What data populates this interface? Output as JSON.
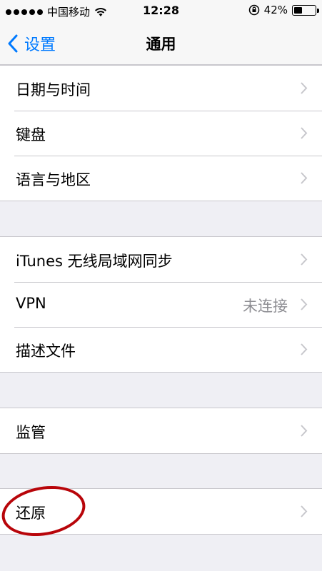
{
  "status_bar": {
    "carrier": "中国移动",
    "time": "12:28",
    "battery": "42%",
    "battery_level": 0.42
  },
  "nav": {
    "back_label": "设置",
    "title": "通用"
  },
  "groups": [
    {
      "rows": [
        {
          "label": "日期与时间"
        },
        {
          "label": "键盘"
        },
        {
          "label": "语言与地区"
        }
      ]
    },
    {
      "rows": [
        {
          "label": "iTunes 无线局域网同步"
        },
        {
          "label": "VPN",
          "value": "未连接"
        },
        {
          "label": "描述文件"
        }
      ]
    },
    {
      "rows": [
        {
          "label": "监管"
        }
      ]
    },
    {
      "rows": [
        {
          "label": "还原"
        }
      ]
    }
  ],
  "colors": {
    "accent": "#007aff",
    "background": "#efeff4",
    "annotation": "#b8050a"
  }
}
